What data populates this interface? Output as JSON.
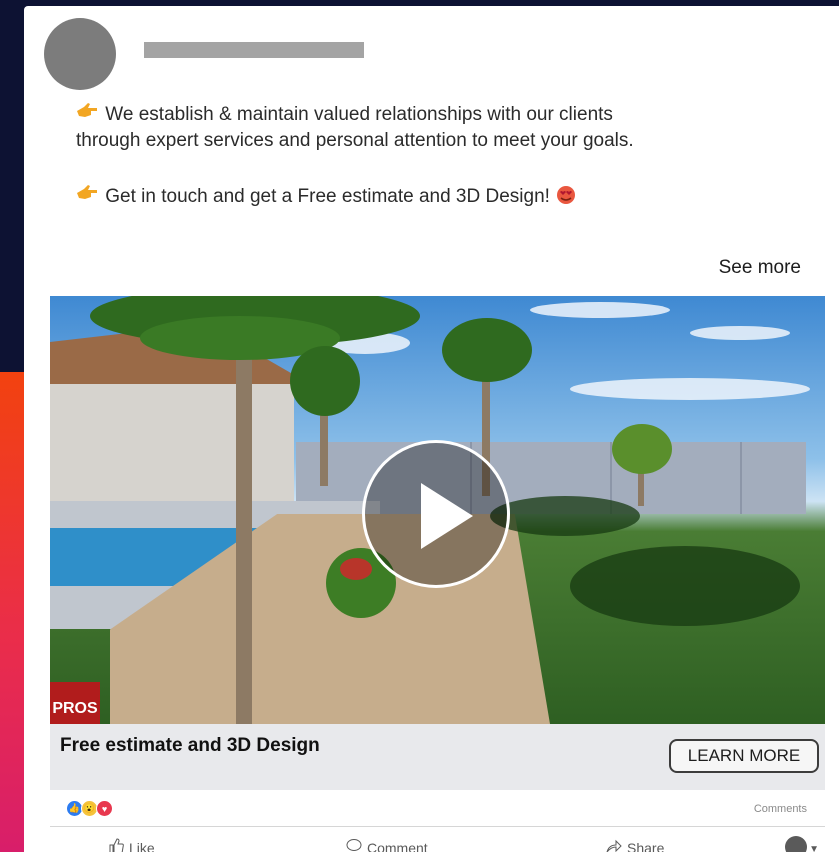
{
  "post": {
    "paragraph1": "We establish & maintain valued relationships with our clients through expert services and personal attention to meet your goals.",
    "paragraph2": "Get in touch and get a Free estimate and 3D Design!",
    "see_more": "See more"
  },
  "video": {
    "logo_text": "PROS"
  },
  "cta": {
    "title": "Free estimate and 3D Design",
    "button": "LEARN MORE"
  },
  "footer": {
    "comments": "Comments",
    "actions": [
      {
        "label": "Like",
        "icon": "thumbs-up-icon"
      },
      {
        "label": "Comment",
        "icon": "comment-bubble-icon"
      },
      {
        "label": "Share",
        "icon": "share-arrow-icon"
      }
    ]
  },
  "colors": {
    "page_background": "#0d1233",
    "accent_stripe": "#ea2d4a",
    "card": "#ffffff",
    "cta_bar": "#e8e9ec"
  }
}
